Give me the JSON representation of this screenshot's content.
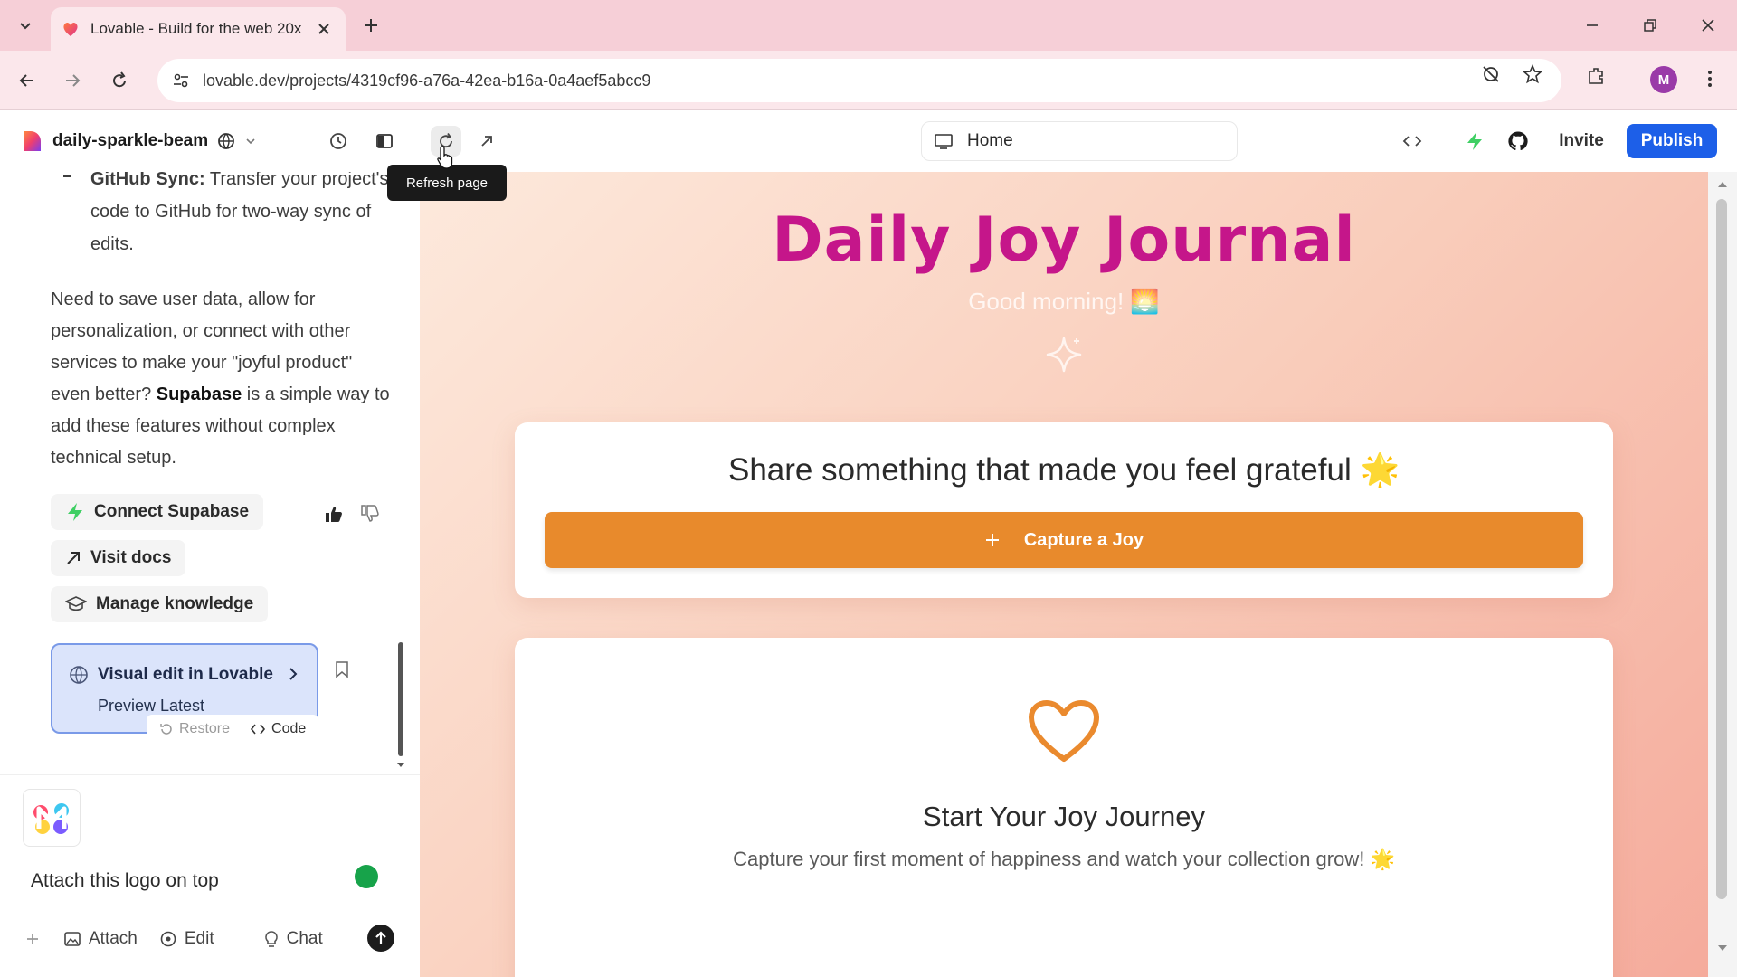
{
  "browser": {
    "tab_title": "Lovable - Build for the web 20x",
    "url": "lovable.dev/projects/4319cf96-a76a-42ea-b16a-0a4aef5abcc9",
    "profile_initial": "M"
  },
  "toolbar": {
    "project_name": "daily-sparkle-beam",
    "route": "Home",
    "invite_label": "Invite",
    "publish_label": "Publish",
    "tooltip": "Refresh page"
  },
  "chat": {
    "bullet_lead": "GitHub Sync:",
    "bullet_text": " Transfer your project's code to GitHub for two-way sync of edits.",
    "para_part1": "Need to save user data, allow for personalization, or connect with other services to make your \"joyful product\" even better? ",
    "para_bold": "Supabase",
    "para_part2": " is a simple way to add these features without complex technical setup.",
    "actions": [
      {
        "label": "Connect Supabase"
      },
      {
        "label": "Visit docs"
      },
      {
        "label": "Manage knowledge"
      }
    ],
    "version_card": {
      "title": "Visual edit in Lovable",
      "subtitle": "Preview Latest",
      "restore_label": "Restore",
      "code_label": "Code"
    },
    "input_text": "Attach this logo on top",
    "bottom_bar": {
      "attach": "Attach",
      "edit": "Edit",
      "chat": "Chat"
    }
  },
  "preview": {
    "title": "Daily Joy Journal",
    "greeting": "Good morning! 🌅",
    "card1_title": "Share something that made you feel grateful 🌟",
    "capture_button": "Capture a Joy",
    "card2_title": "Start Your Joy Journey",
    "card2_subtitle": "Capture your first moment of happiness and watch your collection grow! 🌟"
  },
  "colors": {
    "tabbar": "#f6cfd7",
    "publish": "#1d5fe8",
    "title_magenta": "#c5168a",
    "capture_orange": "#e88a2c",
    "version_card": "#dbe4fb"
  }
}
